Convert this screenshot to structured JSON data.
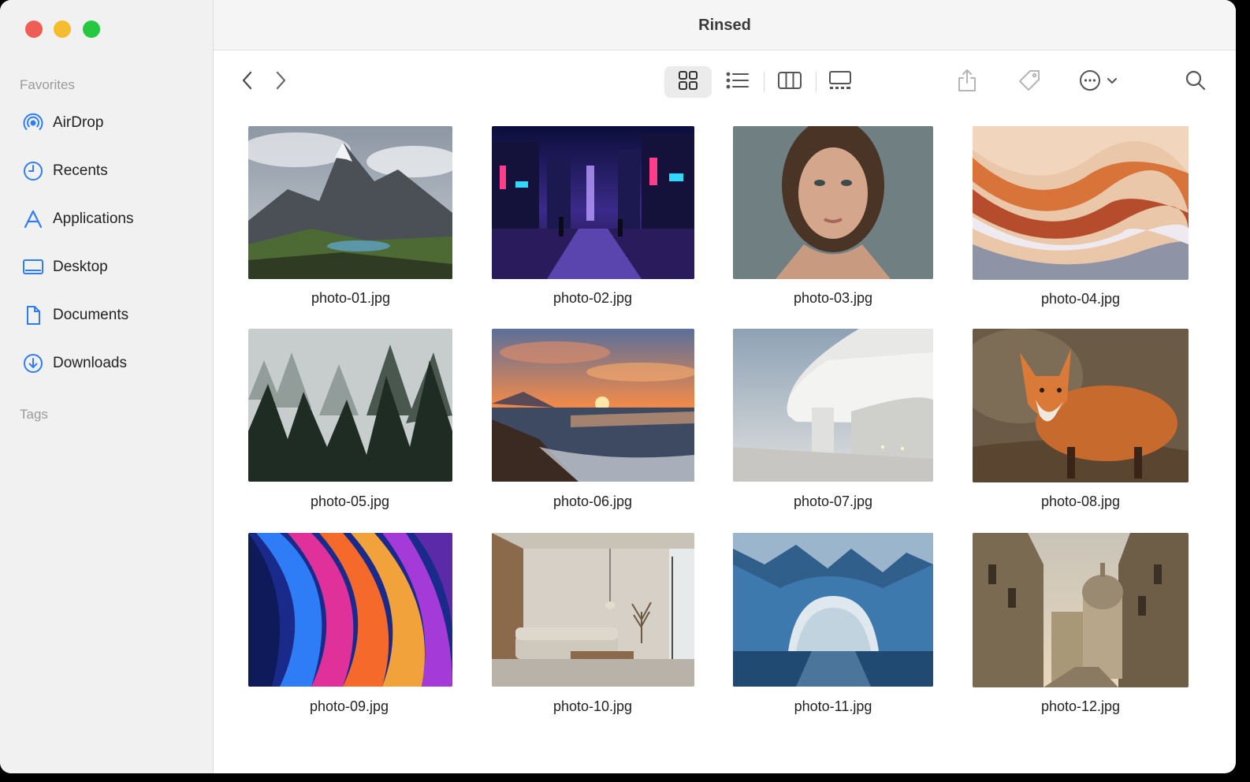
{
  "window": {
    "title": "Rinsed"
  },
  "sidebar": {
    "favorites_header": "Favorites",
    "tags_header": "Tags",
    "items": [
      {
        "label": "AirDrop",
        "icon": "airdrop-icon"
      },
      {
        "label": "Recents",
        "icon": "clock-icon"
      },
      {
        "label": "Applications",
        "icon": "applications-icon"
      },
      {
        "label": "Desktop",
        "icon": "desktop-icon"
      },
      {
        "label": "Documents",
        "icon": "document-icon"
      },
      {
        "label": "Downloads",
        "icon": "download-icon"
      }
    ]
  },
  "toolbar": {
    "view_selected": "icon-view",
    "icons": [
      "back-icon",
      "forward-icon",
      "icon-view-icon",
      "list-view-icon",
      "column-view-icon",
      "gallery-view-icon",
      "share-icon",
      "tag-icon",
      "more-icon",
      "chevron-down-icon",
      "search-icon"
    ]
  },
  "files": [
    {
      "name": "photo-01.jpg",
      "subject": "mountain-landscape"
    },
    {
      "name": "photo-02.jpg",
      "subject": "neon-city-street"
    },
    {
      "name": "photo-03.jpg",
      "subject": "woman-portrait"
    },
    {
      "name": "photo-04.jpg",
      "subject": "abstract-waves"
    },
    {
      "name": "photo-05.jpg",
      "subject": "misty-forest"
    },
    {
      "name": "photo-06.jpg",
      "subject": "sunset-coast"
    },
    {
      "name": "photo-07.jpg",
      "subject": "modern-architecture"
    },
    {
      "name": "photo-08.jpg",
      "subject": "fox"
    },
    {
      "name": "photo-09.jpg",
      "subject": "colorful-abstract"
    },
    {
      "name": "photo-10.jpg",
      "subject": "interior-living-room"
    },
    {
      "name": "photo-11.jpg",
      "subject": "ice-cave-arch"
    },
    {
      "name": "photo-12.jpg",
      "subject": "old-city-street"
    }
  ],
  "colors": {
    "accent": "#2f7df6",
    "sidebar_bg": "#f1f1f1",
    "close": "#ee5e55",
    "minimize": "#f6bc2f",
    "maximize": "#27c840"
  }
}
